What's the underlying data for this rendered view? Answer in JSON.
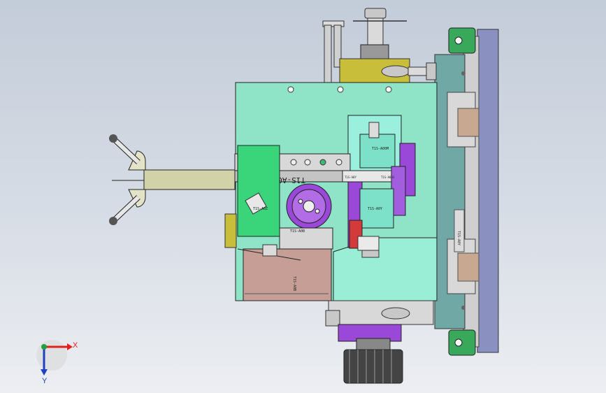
{
  "drawing": {
    "part_label": "T1S-A002",
    "small_labels": {
      "upper_block": "T1S-A00M",
      "slide_left": "T1S-A0Y",
      "slide_right": "T1S-A003",
      "lower_block": "T1S-A0Y",
      "green_block": "T1S-A0Z",
      "lower_plate": "T1S-A0B",
      "pink_plate": "T1S-A0B",
      "right_rail": "T1S-A0Y"
    }
  },
  "triad": {
    "x_label": "X",
    "y_label": "Y",
    "x_color": "#e02020",
    "y_color": "#2040c0",
    "z_color": "#20a040"
  },
  "colors": {
    "base_plate": "#8fe3c7",
    "yellow_block": "#c8be3a",
    "green_block": "#3ad47a",
    "pink_plate": "#c79e96",
    "purple": "#9a48d8",
    "rail": "#7f86b8",
    "grey_part": "#b9b9b9"
  }
}
